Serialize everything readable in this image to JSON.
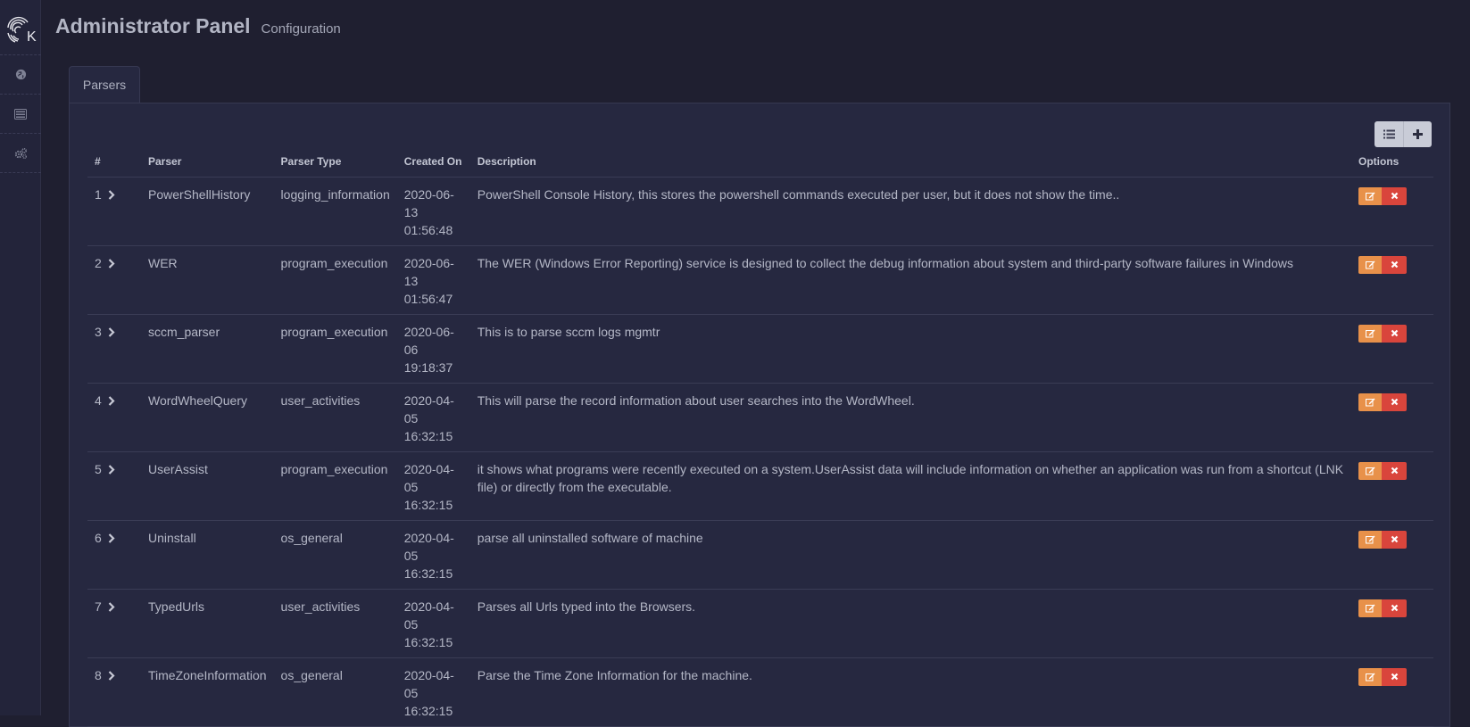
{
  "header": {
    "title": "Administrator Panel",
    "subtitle": "Configuration"
  },
  "sidebar": {
    "items": [
      {
        "name": "globe-icon"
      },
      {
        "name": "list-icon"
      },
      {
        "name": "gears-icon"
      }
    ]
  },
  "tabs": [
    {
      "label": "Parsers"
    }
  ],
  "table": {
    "columns": [
      "#",
      "Parser",
      "Parser Type",
      "Created On",
      "Description",
      "Options"
    ],
    "rows": [
      {
        "num": "1",
        "parser": "PowerShellHistory",
        "type": "logging_information",
        "created": "2020-06-13 01:56:48",
        "description": "PowerShell Console History, this stores the powershell commands executed per user, but it does not show the time.."
      },
      {
        "num": "2",
        "parser": "WER",
        "type": "program_execution",
        "created": "2020-06-13 01:56:47",
        "description": "The WER (Windows Error Reporting) service is designed to collect the debug information about system and third-party software failures in Windows"
      },
      {
        "num": "3",
        "parser": "sccm_parser",
        "type": "program_execution",
        "created": "2020-06-06 19:18:37",
        "description": "This is to parse sccm logs mgmtr"
      },
      {
        "num": "4",
        "parser": "WordWheelQuery",
        "type": "user_activities",
        "created": "2020-04-05 16:32:15",
        "description": "This will parse the record information about user searches into the WordWheel."
      },
      {
        "num": "5",
        "parser": "UserAssist",
        "type": "program_execution",
        "created": "2020-04-05 16:32:15",
        "description": "it shows what programs were recently executed on a system.UserAssist data will include information on whether an application was run from a shortcut (LNK file) or directly from the executable."
      },
      {
        "num": "6",
        "parser": "Uninstall",
        "type": "os_general",
        "created": "2020-04-05 16:32:15",
        "description": "parse all uninstalled software of machine"
      },
      {
        "num": "7",
        "parser": "TypedUrls",
        "type": "user_activities",
        "created": "2020-04-05 16:32:15",
        "description": "Parses all Urls typed into the Browsers."
      },
      {
        "num": "8",
        "parser": "TimeZoneInformation",
        "type": "os_general",
        "created": "2020-04-05 16:32:15",
        "description": "Parse the Time Zone Information for the machine."
      }
    ]
  },
  "colors": {
    "edit": "#e8914a",
    "delete": "#d9453c",
    "background": "#1f1f30",
    "panel": "#262840"
  }
}
